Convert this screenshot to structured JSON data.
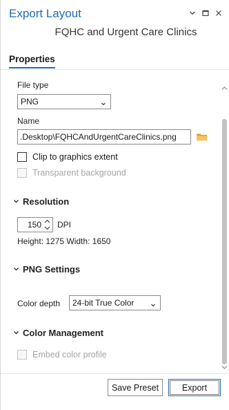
{
  "pane": {
    "title": "Export Layout",
    "subtitle": "FQHC and Urgent Care Clinics",
    "tab_properties": "Properties"
  },
  "form": {
    "file_type_label": "File type",
    "file_type_value": "PNG",
    "name_label": "Name",
    "name_value": ".Desktop\\FQHCAndUrgentCareClinics.png",
    "clip_label": "Clip to graphics extent",
    "transparent_label": "Transparent background"
  },
  "resolution": {
    "header": "Resolution",
    "dpi_value": "150",
    "dpi_unit": "DPI",
    "size_text": "Height: 1275 Width: 1650"
  },
  "png_settings": {
    "header": "PNG Settings",
    "color_depth_label": "Color depth",
    "color_depth_value": "24-bit True Color"
  },
  "color_management": {
    "header": "Color Management",
    "embed_label": "Embed color profile"
  },
  "footer": {
    "save_preset": "Save Preset",
    "export": "Export"
  },
  "colors": {
    "accent": "#1f6bb5",
    "folder": "#e8b64c",
    "disabled_text": "#a6a6a6"
  }
}
